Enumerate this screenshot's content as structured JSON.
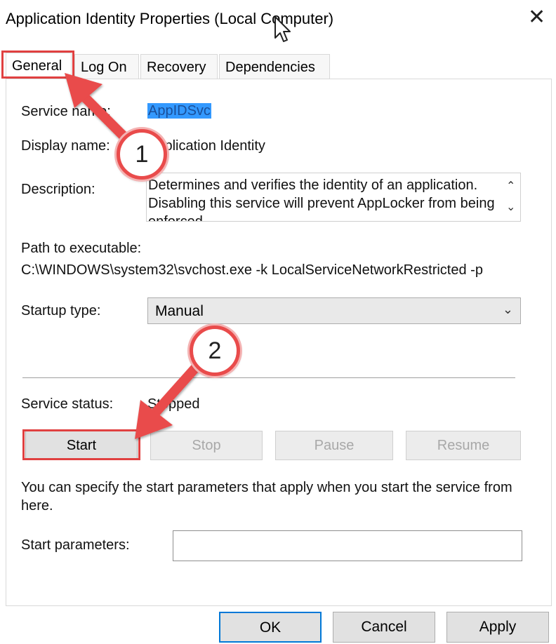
{
  "window": {
    "title": "Application Identity Properties (Local Computer)",
    "close_glyph": "✕"
  },
  "tabs": [
    {
      "label": "General"
    },
    {
      "label": "Log On"
    },
    {
      "label": "Recovery"
    },
    {
      "label": "Dependencies"
    }
  ],
  "general": {
    "service_name_label": "Service name:",
    "service_name_value": "AppIDSvc",
    "display_name_label": "Display name:",
    "display_name_value": "Application Identity",
    "description_label": "Description:",
    "description_value": "Determines and verifies the identity of an application. Disabling this service will prevent AppLocker from being enforced.",
    "path_label": "Path to executable:",
    "path_value": "C:\\WINDOWS\\system32\\svchost.exe -k LocalServiceNetworkRestricted -p",
    "startup_type_label": "Startup type:",
    "startup_type_value": "Manual",
    "service_status_label": "Service status:",
    "service_status_value": "Stopped",
    "buttons": {
      "start": "Start",
      "stop": "Stop",
      "pause": "Pause",
      "resume": "Resume"
    },
    "info_text": "You can specify the start parameters that apply when you start the service from here.",
    "start_params_label": "Start parameters:",
    "start_params_value": ""
  },
  "footer": {
    "ok": "OK",
    "cancel": "Cancel",
    "apply": "Apply"
  },
  "annotations": {
    "step1": "1",
    "step2": "2",
    "highlight_color": "#e04040"
  },
  "icons": {
    "close": "close-icon",
    "scroll_up": "chevron-up-icon",
    "scroll_down": "chevron-down-icon",
    "combo": "chevron-down-icon",
    "cursor": "mouse-cursor-icon"
  }
}
